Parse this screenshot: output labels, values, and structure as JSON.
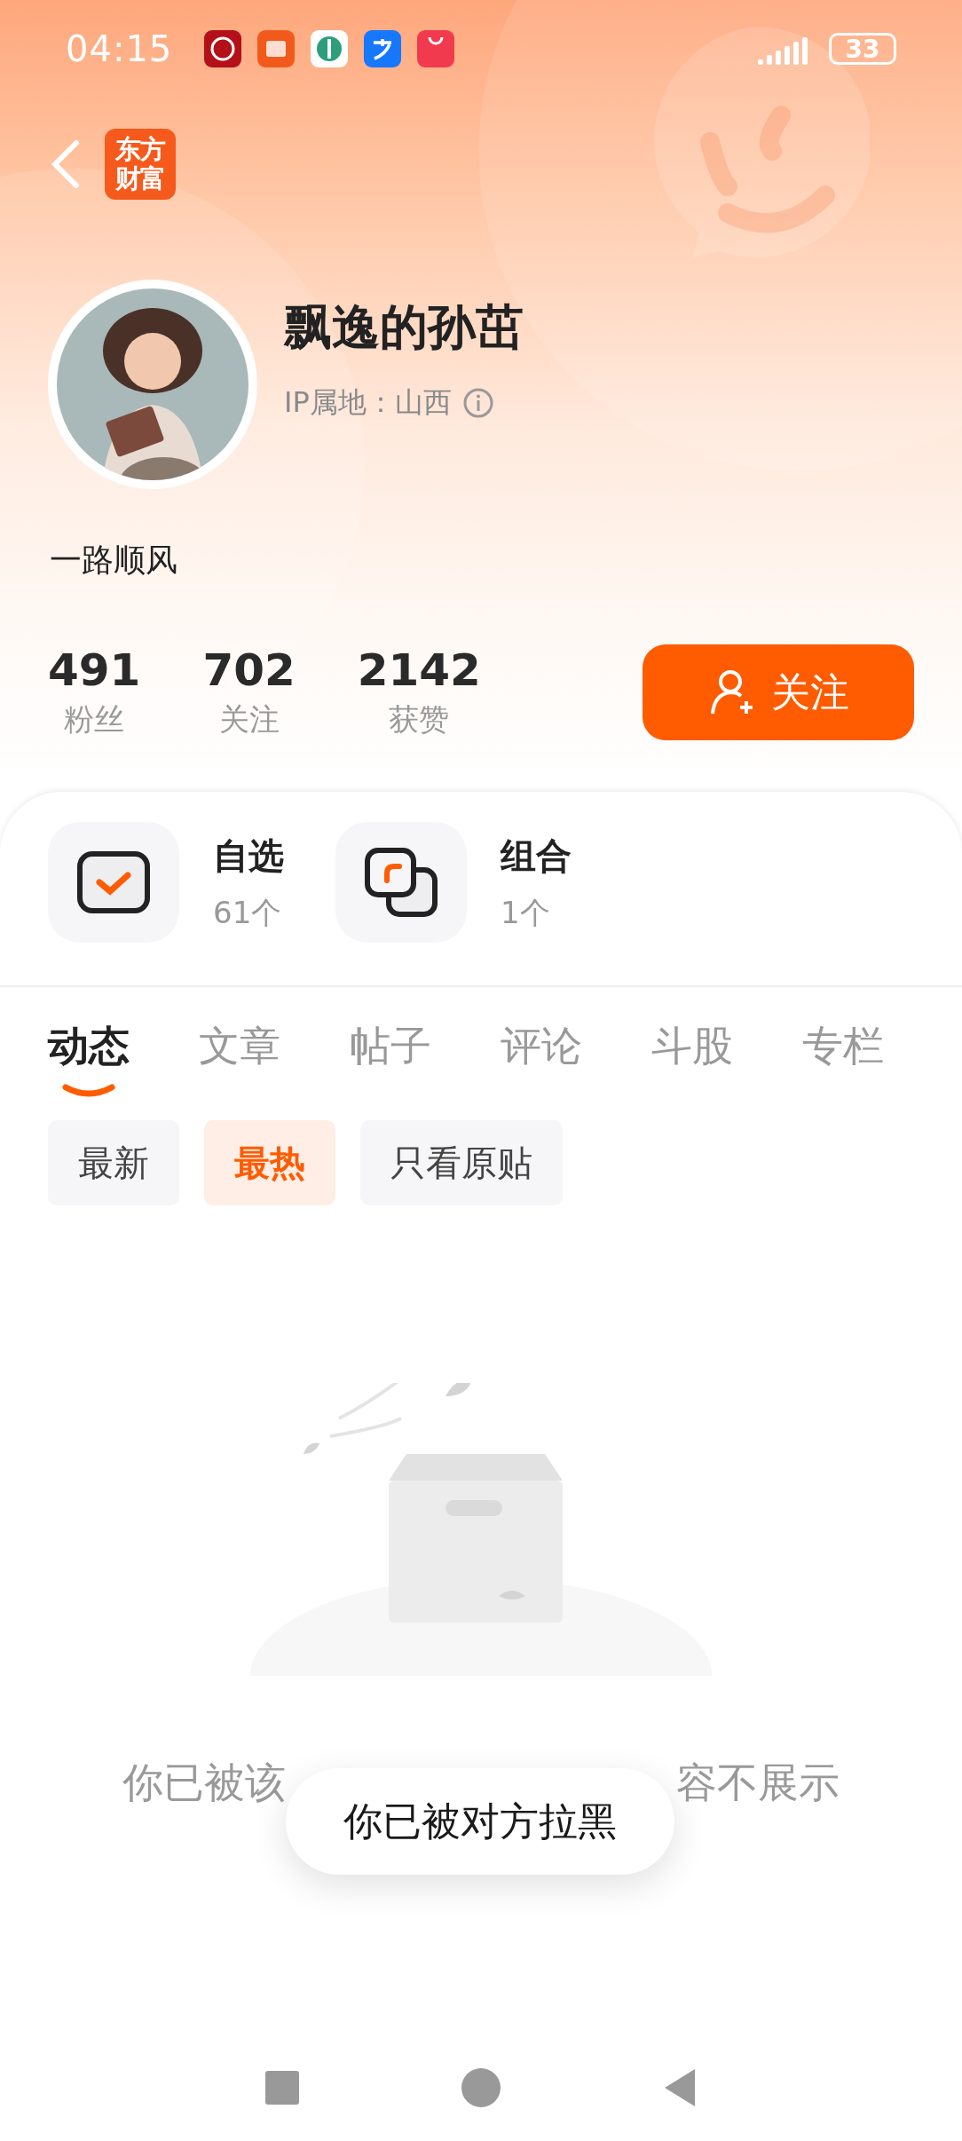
{
  "status_bar": {
    "time": "04:15",
    "battery": "33"
  },
  "header": {
    "logo_lines": [
      "东方",
      "财富"
    ]
  },
  "profile": {
    "name": "飘逸的孙茁",
    "ip_location": "IP属地：山西",
    "bio": "一路顺风"
  },
  "stats": [
    {
      "value": "491",
      "label": "粉丝"
    },
    {
      "value": "702",
      "label": "关注"
    },
    {
      "value": "2142",
      "label": "获赞"
    }
  ],
  "follow_button": {
    "label": "关注"
  },
  "shortcuts": [
    {
      "kind": "watchlist",
      "title": "自选",
      "count": "61个"
    },
    {
      "kind": "portfolio",
      "title": "组合",
      "count": "1个"
    }
  ],
  "tabs": [
    {
      "label": "动态",
      "selected": true
    },
    {
      "label": "文章",
      "selected": false
    },
    {
      "label": "帖子",
      "selected": false
    },
    {
      "label": "评论",
      "selected": false
    },
    {
      "label": "斗股",
      "selected": false
    },
    {
      "label": "专栏",
      "selected": false
    }
  ],
  "filters": [
    {
      "label": "最新",
      "selected": false
    },
    {
      "label": "最热",
      "selected": true
    },
    {
      "label": "只看原贴",
      "selected": false
    }
  ],
  "empty_state": {
    "message_start": "你已被该",
    "message_end": "容不展示"
  },
  "toast": {
    "text": "你已被对方拉黑"
  }
}
